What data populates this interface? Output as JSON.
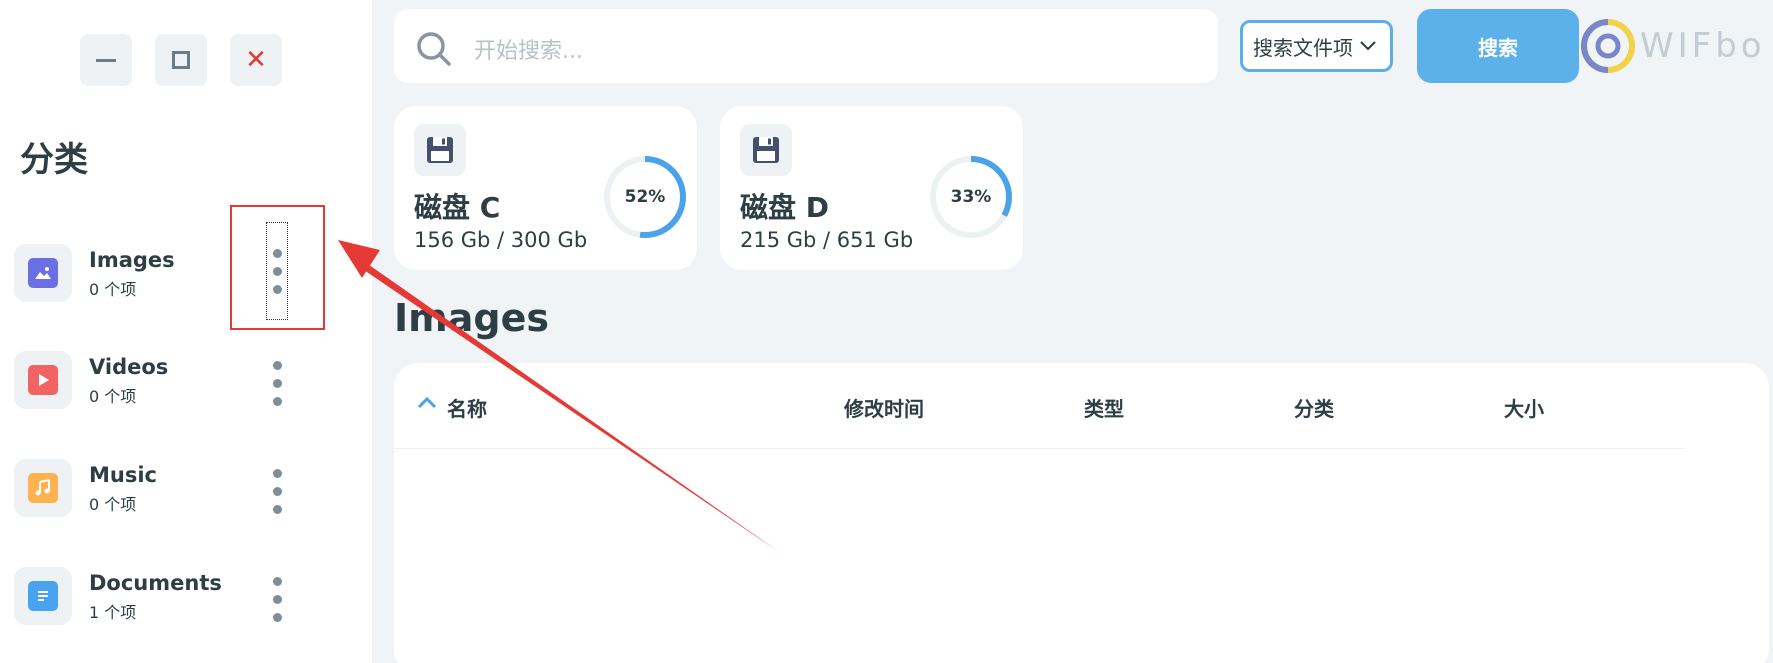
{
  "window_controls": {
    "minimize_icon": "minimize-icon",
    "maximize_icon": "maximize-icon",
    "close_glyph": "✕"
  },
  "sidebar": {
    "title": "分类",
    "items": [
      {
        "name": "Images",
        "count": "0  个项",
        "icon": "image-icon",
        "color": "#6c6ee4"
      },
      {
        "name": "Videos",
        "count": "0  个项",
        "icon": "play-icon",
        "color": "#f26363"
      },
      {
        "name": "Music",
        "count": "0  个项",
        "icon": "music-note-icon",
        "color": "#ffb24d"
      },
      {
        "name": "Documents",
        "count": "1  个项",
        "icon": "document-icon",
        "color": "#4aa3f0"
      }
    ]
  },
  "search": {
    "placeholder": "开始搜索...",
    "scope_label": "搜索文件项",
    "button_label": "搜索"
  },
  "logo": {
    "text": "WIFbo"
  },
  "disks": [
    {
      "name": "磁盘 C",
      "usage": "156 Gb / 300 Gb",
      "percent_label": "52%",
      "percent": 0.52
    },
    {
      "name": "磁盘 D",
      "usage": "215 Gb / 651 Gb",
      "percent_label": "33%",
      "percent": 0.33
    }
  ],
  "main": {
    "section_title": "Images",
    "columns": [
      "名称",
      "修改时间",
      "类型",
      "分类",
      "大小"
    ]
  },
  "colors": {
    "accent": "#5cb1ea",
    "annotation_red": "#e53935"
  }
}
